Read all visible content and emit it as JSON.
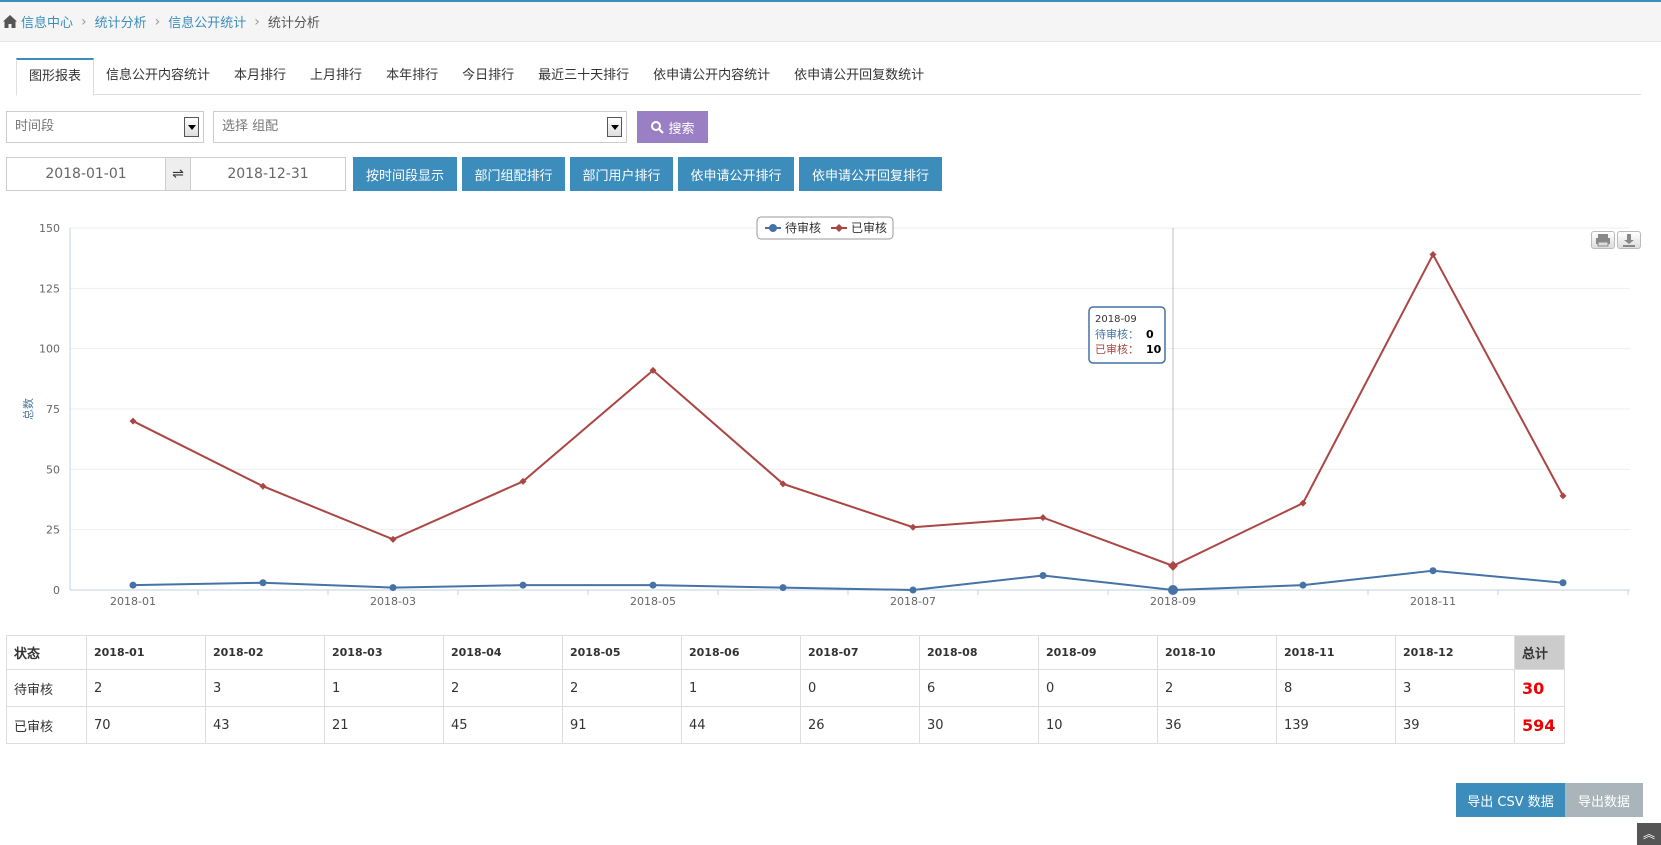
{
  "breadcrumb": {
    "items": [
      "信息中心",
      "统计分析",
      "信息公开统计"
    ],
    "current": "统计分析"
  },
  "tabs": [
    "图形报表",
    "信息公开内容统计",
    "本月排行",
    "上月排行",
    "本年排行",
    "今日排行",
    "最近三十天排行",
    "依申请公开内容统计",
    "依申请公开回复数统计"
  ],
  "filters": {
    "period_placeholder": "时间段",
    "group_placeholder": "选择 组配",
    "search_label": "搜索",
    "date_from": "2018-01-01",
    "date_to": "2018-12-31",
    "swap_symbol": "⇌",
    "buttons": [
      "按时间段显示",
      "部门组配排行",
      "部门用户排行",
      "依申请公开排行",
      "依申请公开回复排行"
    ]
  },
  "chart_data": {
    "type": "line",
    "x": [
      "2018-01",
      "2018-02",
      "2018-03",
      "2018-04",
      "2018-05",
      "2018-06",
      "2018-07",
      "2018-08",
      "2018-09",
      "2018-10",
      "2018-11",
      "2018-12"
    ],
    "xtick_labels": [
      "2018-01",
      "2018-03",
      "2018-05",
      "2018-07",
      "2018-09",
      "2018-11"
    ],
    "ylabel": "总数",
    "ylim": [
      0,
      150
    ],
    "yticks": [
      0,
      25,
      50,
      75,
      100,
      125,
      150
    ],
    "grid": true,
    "legend": "top-center",
    "series": [
      {
        "name": "待审核",
        "color": "#4572a7",
        "values": [
          2,
          3,
          1,
          2,
          2,
          1,
          0,
          6,
          0,
          2,
          8,
          3
        ]
      },
      {
        "name": "已审核",
        "color": "#aa4643",
        "values": [
          70,
          43,
          21,
          45,
          91,
          44,
          26,
          30,
          10,
          36,
          139,
          39
        ]
      }
    ],
    "tooltip": {
      "x": "2018-09",
      "rows": [
        {
          "name": "待审核",
          "value": "0"
        },
        {
          "name": "已审核",
          "value": "10"
        }
      ]
    }
  },
  "table": {
    "status_header": "状态",
    "months": [
      "2018-01",
      "2018-02",
      "2018-03",
      "2018-04",
      "2018-05",
      "2018-06",
      "2018-07",
      "2018-08",
      "2018-09",
      "2018-10",
      "2018-11",
      "2018-12"
    ],
    "total_header": "总计",
    "rows": [
      {
        "label": "待审核",
        "values": [
          "2",
          "3",
          "1",
          "2",
          "2",
          "1",
          "0",
          "6",
          "0",
          "2",
          "8",
          "3"
        ],
        "total": "30"
      },
      {
        "label": "已审核",
        "values": [
          "70",
          "43",
          "21",
          "45",
          "91",
          "44",
          "26",
          "30",
          "10",
          "36",
          "139",
          "39"
        ],
        "total": "594"
      }
    ]
  },
  "export": {
    "csv_label": "导出 CSV 数据",
    "export_label": "导出数据"
  },
  "colors": {
    "accent": "#3c8dbc",
    "search": "#9b7fc4",
    "total": "#ee0000"
  },
  "icons": [
    "home-icon",
    "search-icon",
    "print-icon",
    "download-icon",
    "double-up-icon"
  ]
}
